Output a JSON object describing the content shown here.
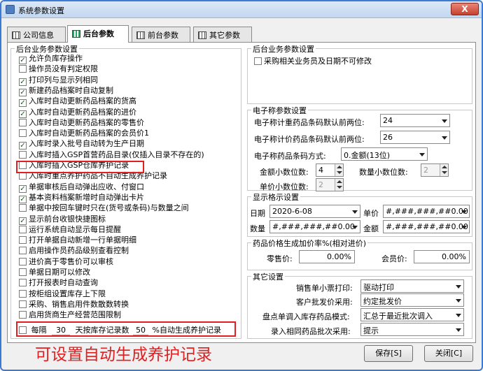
{
  "window": {
    "title": "系统参数设置",
    "close": "X"
  },
  "tabs": [
    "公司信息",
    "后台参数",
    "前台参数",
    "其它参数"
  ],
  "left_group": {
    "title": "后台业务参数设置",
    "items": [
      {
        "label": "允许负库存操作",
        "checked": true
      },
      {
        "label": "操作员没有判定权限",
        "checked": false
      },
      {
        "label": "打印列与显示列相同",
        "checked": true
      },
      {
        "label": "新建药品档案时自动复制",
        "checked": true
      },
      {
        "label": "入库时自动更新药品档案的货高",
        "checked": true
      },
      {
        "label": "入库时自动更新药品档案的进价",
        "checked": true
      },
      {
        "label": "入库时自动更新药品档案的零售价",
        "checked": false
      },
      {
        "label": "入库时自动更新药品档案的会员价1",
        "checked": false
      },
      {
        "label": "入库时录入批号自动转为生产日期",
        "checked": true
      },
      {
        "label": "入库时插入GSP首营药品目录(仅插入目录不存在的)",
        "checked": false
      },
      {
        "label": "入库时插入GSP仓库养护记录",
        "checked": false
      },
      {
        "label": "入库时重点养护药品不自动生成养护记录",
        "checked": false
      },
      {
        "label": "单据审核后自动弹出应收、付窗口",
        "checked": true
      },
      {
        "label": "基本资料档案新增时自动弹出卡片",
        "checked": true
      },
      {
        "label": "单据中按回车键时只在(货号或条码)与数量之间",
        "checked": false
      },
      {
        "label": "显示前台收银快捷图标",
        "checked": true
      },
      {
        "label": "运行系统自动显示每日提醒",
        "checked": false
      },
      {
        "label": "打开单据自动新增一行单据明细",
        "checked": false
      },
      {
        "label": "启用操作员药品级别查看控制",
        "checked": false
      },
      {
        "label": "进价高于零售价可以审核",
        "checked": false
      },
      {
        "label": "单据日期可以修改",
        "checked": false
      },
      {
        "label": "打开报表时自动查询",
        "checked": false
      },
      {
        "label": "按柜组设置库存上下限",
        "checked": false
      },
      {
        "label": "采购、销售启用件数散数转换",
        "checked": false
      },
      {
        "label": "启用货商生产经营范围限制",
        "checked": false
      }
    ],
    "auto_row": {
      "prefix": "每隔",
      "days": "30",
      "mid": "天按库存记录数",
      "percent": "50",
      "suffix": "%自动生成养护记录",
      "checked": false
    }
  },
  "right_top": {
    "title": "后台业务参数设置",
    "checkbox": "采购相关业务员及日期不可修改",
    "checked": false
  },
  "scale": {
    "title": "电子称参数设置",
    "weight_label": "电子称计重药品条码默认前两位:",
    "weight_value": "24",
    "price_label": "电子称计价药品条码默认前两位:",
    "price_value": "26",
    "mode_label": "电子称药品条码方式:",
    "mode_value": "0.金额(13位)",
    "amt_dec_label": "金额小数位数:",
    "amt_dec_value": "4",
    "qty_dec_label": "数量小数位数:",
    "qty_dec_value": "2",
    "price_dec_label": "单价小数位数:",
    "price_dec_value": "2"
  },
  "format": {
    "title": "显示格示设置",
    "date_label": "日期",
    "date_value": "2020-6-08",
    "unit_label": "单价",
    "unit_value": "#,###,###,##0.00",
    "qty_label": "数量",
    "qty_value": "#,###,###,##0.00",
    "amount_label": "金额",
    "amount_value": "#,###,###,##0.00"
  },
  "markup": {
    "title": "药品价格生成加价率%(相对进价)",
    "retail_label": "零售价:",
    "retail_value": "0.00%",
    "member_label": "会员价:",
    "member_value": "0.00%"
  },
  "other": {
    "title": "其它设置",
    "rows": [
      {
        "label": "销售单小票打印:",
        "value": "驱动打印"
      },
      {
        "label": "客户批发价采用:",
        "value": "约定批发价"
      },
      {
        "label": "盘点单调入库存药品模式:",
        "value": "汇总于最近批次调入"
      },
      {
        "label": "录入相同药品批次采用:",
        "value": "提示"
      }
    ]
  },
  "buttons": {
    "save": "保存[S]",
    "close": "关闭[C]"
  },
  "annotation": "可设置自动生成养护记录"
}
